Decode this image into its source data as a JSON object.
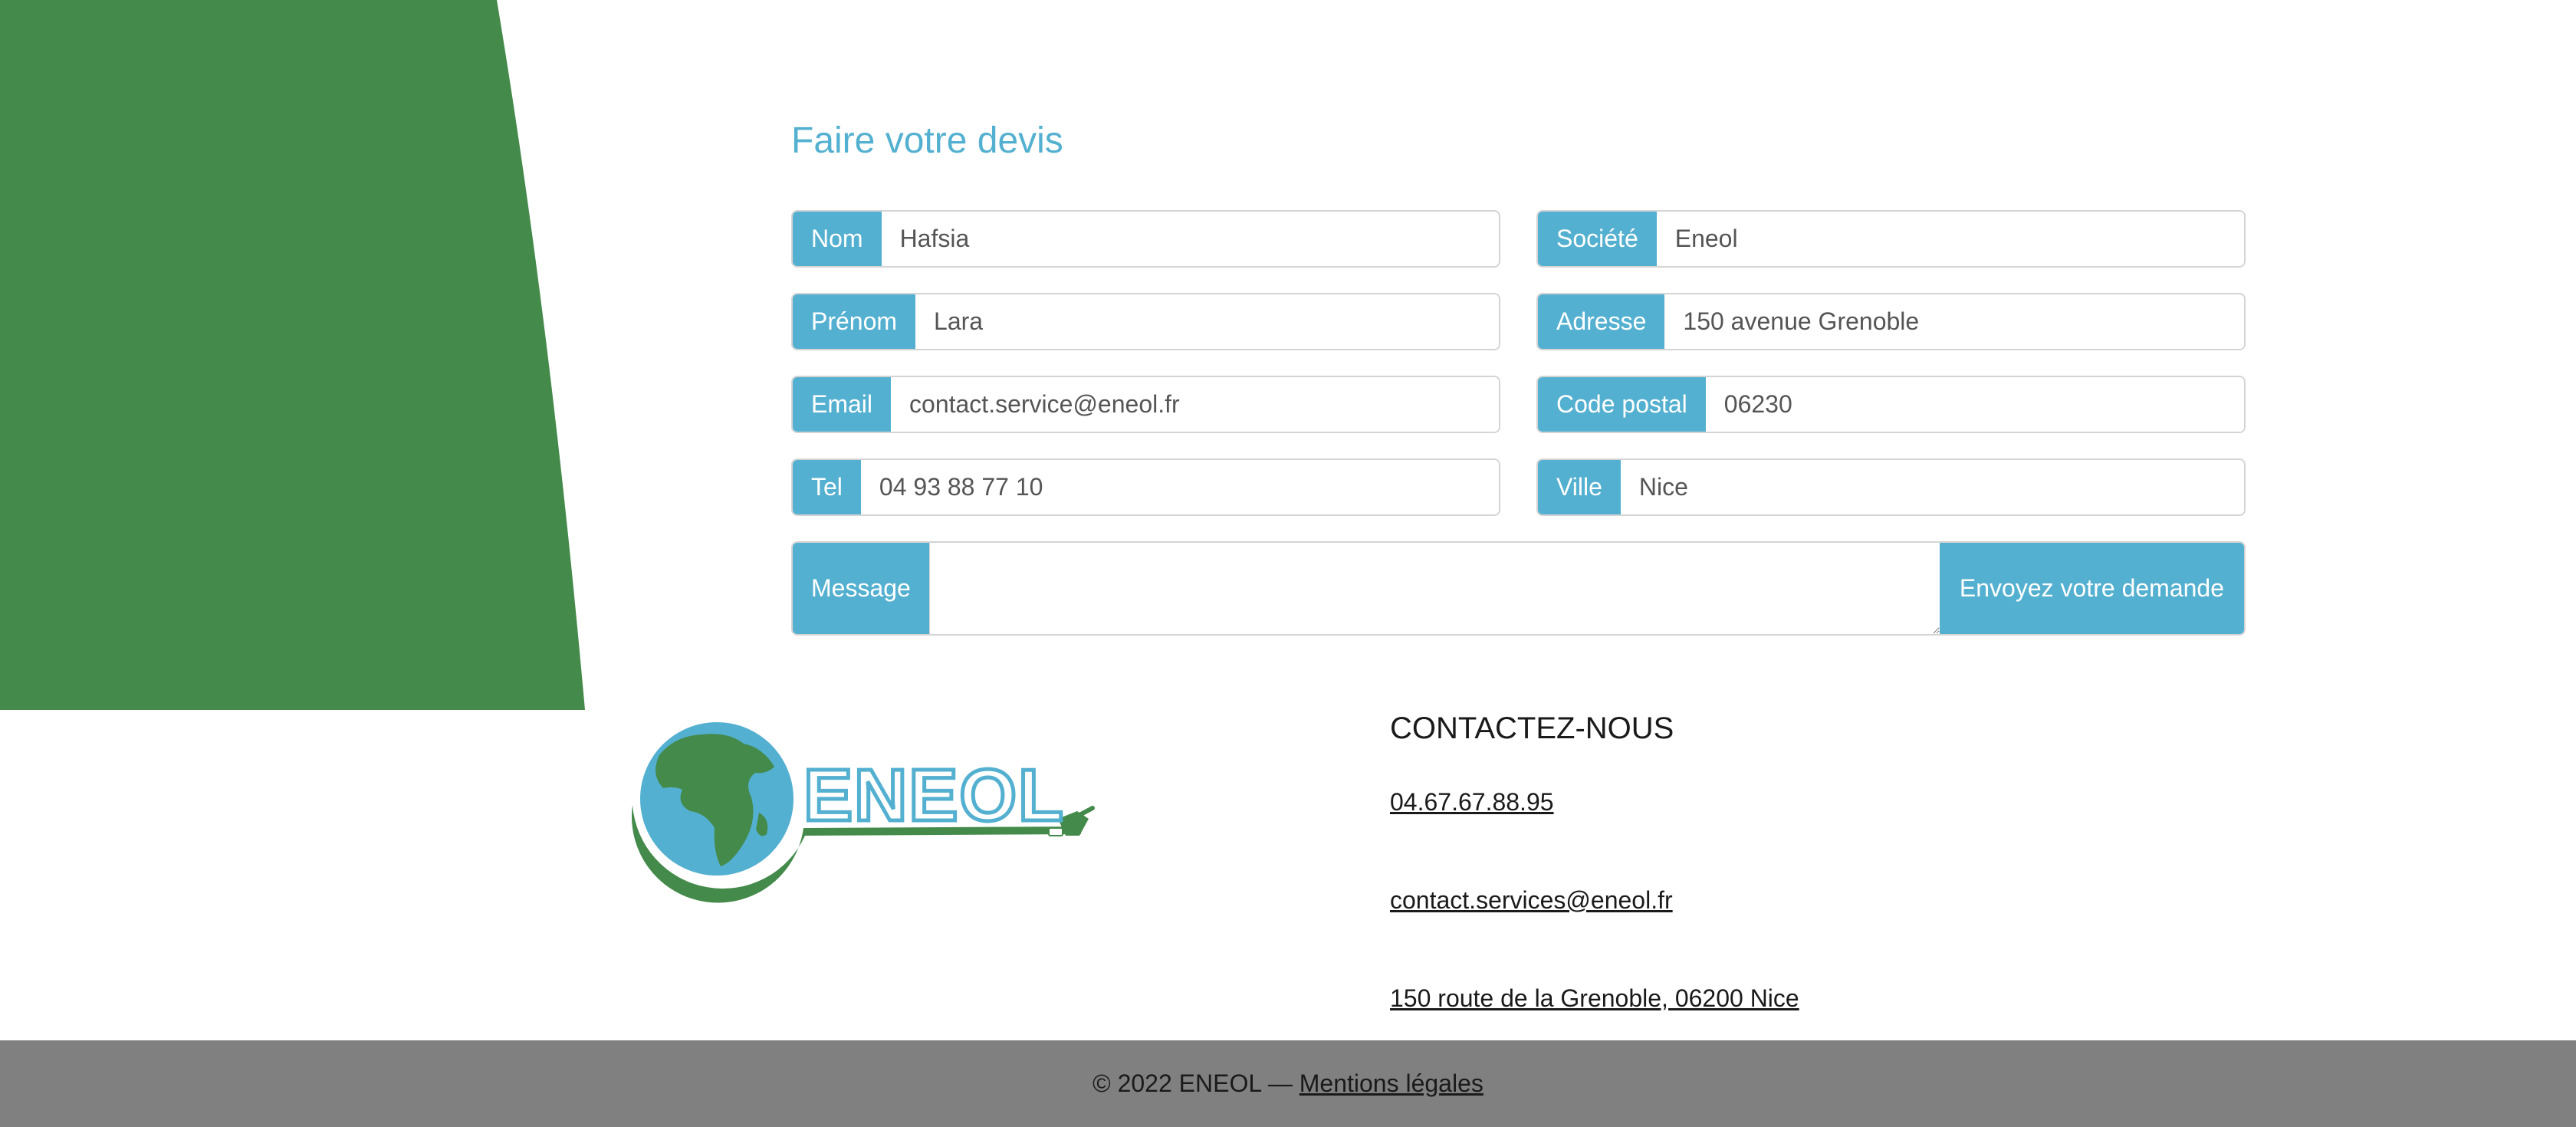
{
  "form": {
    "title": "Faire votre devis",
    "fields": {
      "nom": {
        "label": "Nom",
        "value": "Hafsia"
      },
      "prenom": {
        "label": "Prénom",
        "value": "Lara"
      },
      "email": {
        "label": "Email",
        "value": "contact.service@eneol.fr"
      },
      "tel": {
        "label": "Tel",
        "value": "04 93 88 77 10"
      },
      "societe": {
        "label": "Société",
        "value": "Eneol"
      },
      "adresse": {
        "label": "Adresse",
        "value": "150 avenue Grenoble"
      },
      "code_postal": {
        "label": "Code postal",
        "value": "06230"
      },
      "ville": {
        "label": "Ville",
        "value": "Nice"
      },
      "message": {
        "label": "Message",
        "value": ""
      }
    },
    "submit_label": "Envoyez votre demande"
  },
  "logo": {
    "text": "ENEOL"
  },
  "contact": {
    "title": "CONTACTEZ-NOUS",
    "phone": "04.67.67.88.95",
    "email": "contact.services@eneol.fr",
    "address": "150 route de la Grenoble, 06200 Nice"
  },
  "footer": {
    "copyright": "© 2022 ENEOL — ",
    "legal_link": "Mentions légales"
  },
  "colors": {
    "accent": "#54b0d0",
    "green": "#448a4b",
    "footer_bg": "#808080"
  }
}
